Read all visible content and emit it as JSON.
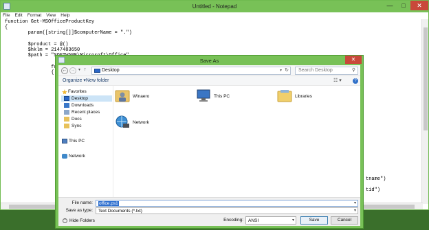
{
  "notepad": {
    "title": "Untitled - Notepad",
    "controls": {
      "minimize": "—",
      "maximize": "□",
      "close": "✕"
    },
    "menu": [
      "File",
      "Edit",
      "Format",
      "View",
      "Help"
    ],
    "code_lines": [
      "function Get-MSOfficeProductKey",
      "{",
      "        param([string[]]$computerName = \".\")",
      "",
      "        $product = @()",
      "        $hklm = 2147483650",
      "        $path = \"SOFTWARE\\Microsoft\\Office\"",
      "",
      "                foreach",
      "                {"
    ],
    "overflow_right": [
      "tname\")",
      "",
      "tid\")"
    ]
  },
  "dialog": {
    "title": "Save As",
    "close": "✕",
    "address": {
      "back": "←",
      "forward": "→",
      "recent": "▾",
      "up": "↑",
      "location": "Desktop",
      "dropdown": "▾",
      "refresh": "↻",
      "search_placeholder": "Search Desktop",
      "search_icon": "⚲"
    },
    "command_bar": {
      "organize": "Organize ▾",
      "new_folder": "New folder",
      "views": "☷ ▾",
      "help": "?"
    },
    "nav_pane": {
      "favorites_header": "Favorites",
      "favorites": [
        "Desktop",
        "Downloads",
        "Recent places",
        "Docs",
        "Sync"
      ],
      "this_pc": "This PC",
      "network": "Network"
    },
    "items": [
      {
        "label": "Winaero",
        "icon": "user-folder-icon"
      },
      {
        "label": "This PC",
        "icon": "computer-icon"
      },
      {
        "label": "Libraries",
        "icon": "libraries-folder-icon"
      },
      {
        "label": "Network",
        "icon": "network-globe-icon"
      }
    ],
    "file_name_label": "File name:",
    "file_name_value": "office.ps1",
    "save_type_label": "Save as type:",
    "save_type_value": "Text Documents (*.txt)",
    "hide_folders": "Hide Folders",
    "encoding_label": "Encoding:",
    "encoding_value": "ANSI",
    "save_button": "Save",
    "cancel_button": "Cancel"
  },
  "colors": {
    "accent": "#78c157",
    "close": "#c9483a",
    "selection": "#cce4f7"
  }
}
